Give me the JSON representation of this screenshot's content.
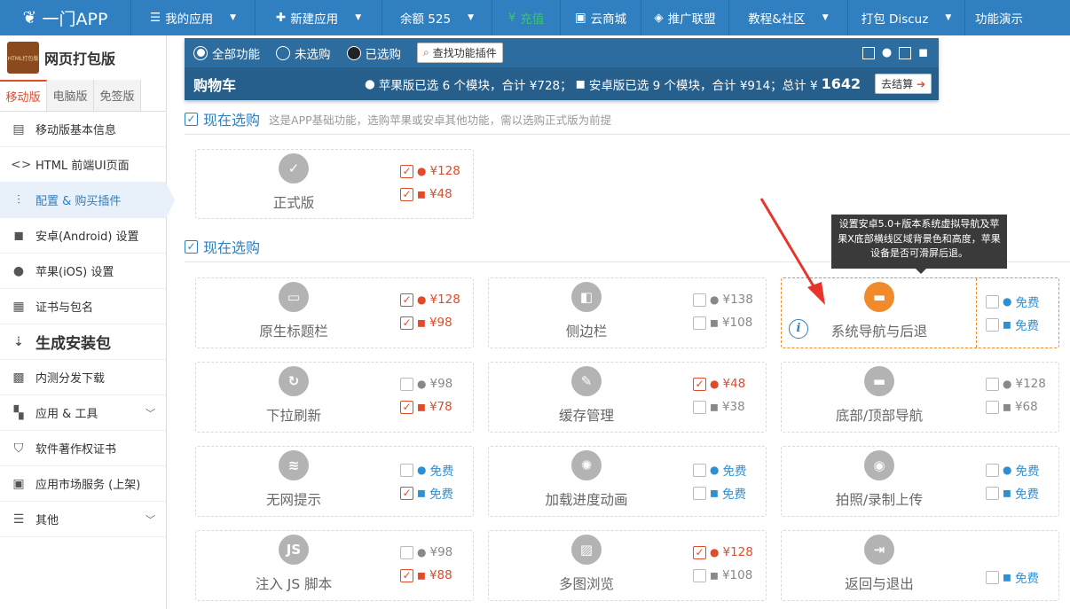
{
  "topbar": {
    "logo": "一门APP",
    "items": [
      {
        "label": "我的应用",
        "icon": "list-icon",
        "caret": true
      },
      {
        "label": "新建应用",
        "icon": "plus-icon",
        "caret": true
      },
      {
        "label": "余额 525",
        "icon": "",
        "caret": true
      },
      {
        "label": "充值",
        "icon": "yen-circle-icon",
        "caret": false
      },
      {
        "label": "云商城",
        "icon": "bag-icon",
        "caret": false
      },
      {
        "label": "推广联盟",
        "icon": "diamond-icon",
        "caret": false
      },
      {
        "label": "教程&社区",
        "icon": "",
        "caret": true
      },
      {
        "label": "打包 Discuz",
        "icon": "",
        "caret": true
      },
      {
        "label": "功能演示",
        "icon": "",
        "caret": false
      }
    ]
  },
  "sidebar": {
    "logo_text": "HTML打包版",
    "title": "网页打包版",
    "tabs": [
      "移动版",
      "电脑版",
      "免签版"
    ],
    "items": [
      {
        "label": "移动版基本信息",
        "icon": "document-icon"
      },
      {
        "label": "HTML 前端UI页面",
        "icon": "code-icon"
      },
      {
        "label": "配置 & 购买插件",
        "icon": "sliders-icon"
      },
      {
        "label": "安卓(Android) 设置",
        "icon": "android-icon"
      },
      {
        "label": "苹果(iOS) 设置",
        "icon": "apple-icon"
      },
      {
        "label": "证书与包名",
        "icon": "certificate-icon"
      },
      {
        "label": "生成安装包",
        "icon": "download-icon"
      },
      {
        "label": "内测分发下载",
        "icon": "qrcode-icon"
      },
      {
        "label": "应用 & 工具",
        "icon": "apps-icon"
      },
      {
        "label": "软件著作权证书",
        "icon": "shield-icon"
      },
      {
        "label": "应用市场服务 (上架)",
        "icon": "store-icon"
      },
      {
        "label": "其他",
        "icon": "menu-icon"
      }
    ]
  },
  "filter": {
    "options": [
      "全部功能",
      "未选购",
      "已选购"
    ],
    "search_label": "查找功能插件",
    "cart_label": "购物车",
    "summary_ios": "苹果版已选 6 个模块，合计 ¥728；",
    "summary_android": "安卓版已选 9 个模块，合计 ¥914；总计 ¥",
    "total": "1642",
    "checkout_label": "去结算"
  },
  "sections": [
    {
      "title": "现在选购",
      "note": "这是APP基础功能，选购苹果或安卓其他功能，需以选购正式版为前提"
    },
    {
      "title": "现在选购",
      "note": ""
    }
  ],
  "cards": [
    {
      "name": "正式版",
      "icon": "shield-check-icon",
      "ios": {
        "price": "¥128",
        "checked": true
      },
      "android": {
        "price": "¥48",
        "checked": true
      }
    },
    {
      "name": "原生标题栏",
      "icon": "window-icon",
      "ios": {
        "price": "¥128",
        "checked": true
      },
      "android": {
        "price": "¥98",
        "checked": true
      }
    },
    {
      "name": "侧边栏",
      "icon": "sidebar-icon",
      "ios": {
        "price": "¥138",
        "checked": false
      },
      "android": {
        "price": "¥108",
        "checked": false
      }
    },
    {
      "name": "系统导航与后退",
      "icon": "nav-bar-icon",
      "ios": {
        "price": "免费",
        "checked": false
      },
      "android": {
        "price": "免费",
        "checked": false
      }
    },
    {
      "name": "下拉刷新",
      "icon": "refresh-icon",
      "ios": {
        "price": "¥98",
        "checked": false
      },
      "android": {
        "price": "¥78",
        "checked": true
      }
    },
    {
      "name": "缓存管理",
      "icon": "broom-icon",
      "ios": {
        "price": "¥48",
        "checked": true
      },
      "android": {
        "price": "¥38",
        "checked": false
      }
    },
    {
      "name": "底部/顶部导航",
      "icon": "tabs-icon",
      "ios": {
        "price": "¥128",
        "checked": false
      },
      "android": {
        "price": "¥68",
        "checked": false
      }
    },
    {
      "name": "无网提示",
      "icon": "wifi-off-icon",
      "ios": {
        "price": "免费",
        "checked": false
      },
      "android": {
        "price": "免费",
        "checked": true
      }
    },
    {
      "name": "加载进度动画",
      "icon": "spinner-icon",
      "ios": {
        "price": "免费",
        "checked": false
      },
      "android": {
        "price": "免费",
        "checked": false
      }
    },
    {
      "name": "拍照/录制上传",
      "icon": "camera-icon",
      "ios": {
        "price": "免费",
        "checked": false
      },
      "android": {
        "price": "免费",
        "checked": false
      }
    },
    {
      "name": "注入 JS 脚本",
      "icon": "js-icon",
      "ios": {
        "price": "¥98",
        "checked": false
      },
      "android": {
        "price": "¥88",
        "checked": true
      }
    },
    {
      "name": "多图浏览",
      "icon": "image-icon",
      "ios": {
        "price": "¥128",
        "checked": true
      },
      "android": {
        "price": "¥108",
        "checked": false
      }
    },
    {
      "name": "返回与退出",
      "icon": "exit-icon",
      "ios": null,
      "android": {
        "price": "免费",
        "checked": false
      }
    }
  ],
  "tooltip": "设置安卓5.0+版本系统虚拟导航及苹果X底部横线区域背景色和高度，苹果设备是否可滑屏后退。",
  "colors": {
    "primary": "#2f7fc1",
    "selected": "#e04b2a",
    "free": "#2f8fd3",
    "highlight": "#f08a2a"
  }
}
